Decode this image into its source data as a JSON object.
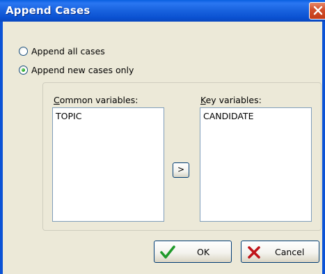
{
  "window": {
    "title": "Append Cases",
    "close_icon": "close-icon"
  },
  "options": {
    "append_all_label": "Append all cases",
    "append_new_label": "Append new cases only",
    "selected": "append_new"
  },
  "common": {
    "label": "Common variables:",
    "label_accel": "C",
    "label_rest": "ommon variables:",
    "items": [
      "TOPIC"
    ]
  },
  "key": {
    "label": "Key variables:",
    "label_accel": "K",
    "label_rest": "ey variables:",
    "items": [
      "CANDIDATE"
    ]
  },
  "move_button": {
    "label": ">"
  },
  "buttons": {
    "ok_label": "OK",
    "ok_icon": "checkmark-icon",
    "cancel_label": "Cancel",
    "cancel_icon": "x-cross-icon"
  },
  "colors": {
    "titlebar": "#0b53d6",
    "dialog_bg": "#ece9d8",
    "ok_check": "#1f9a2a",
    "cancel_x": "#c0141a"
  }
}
